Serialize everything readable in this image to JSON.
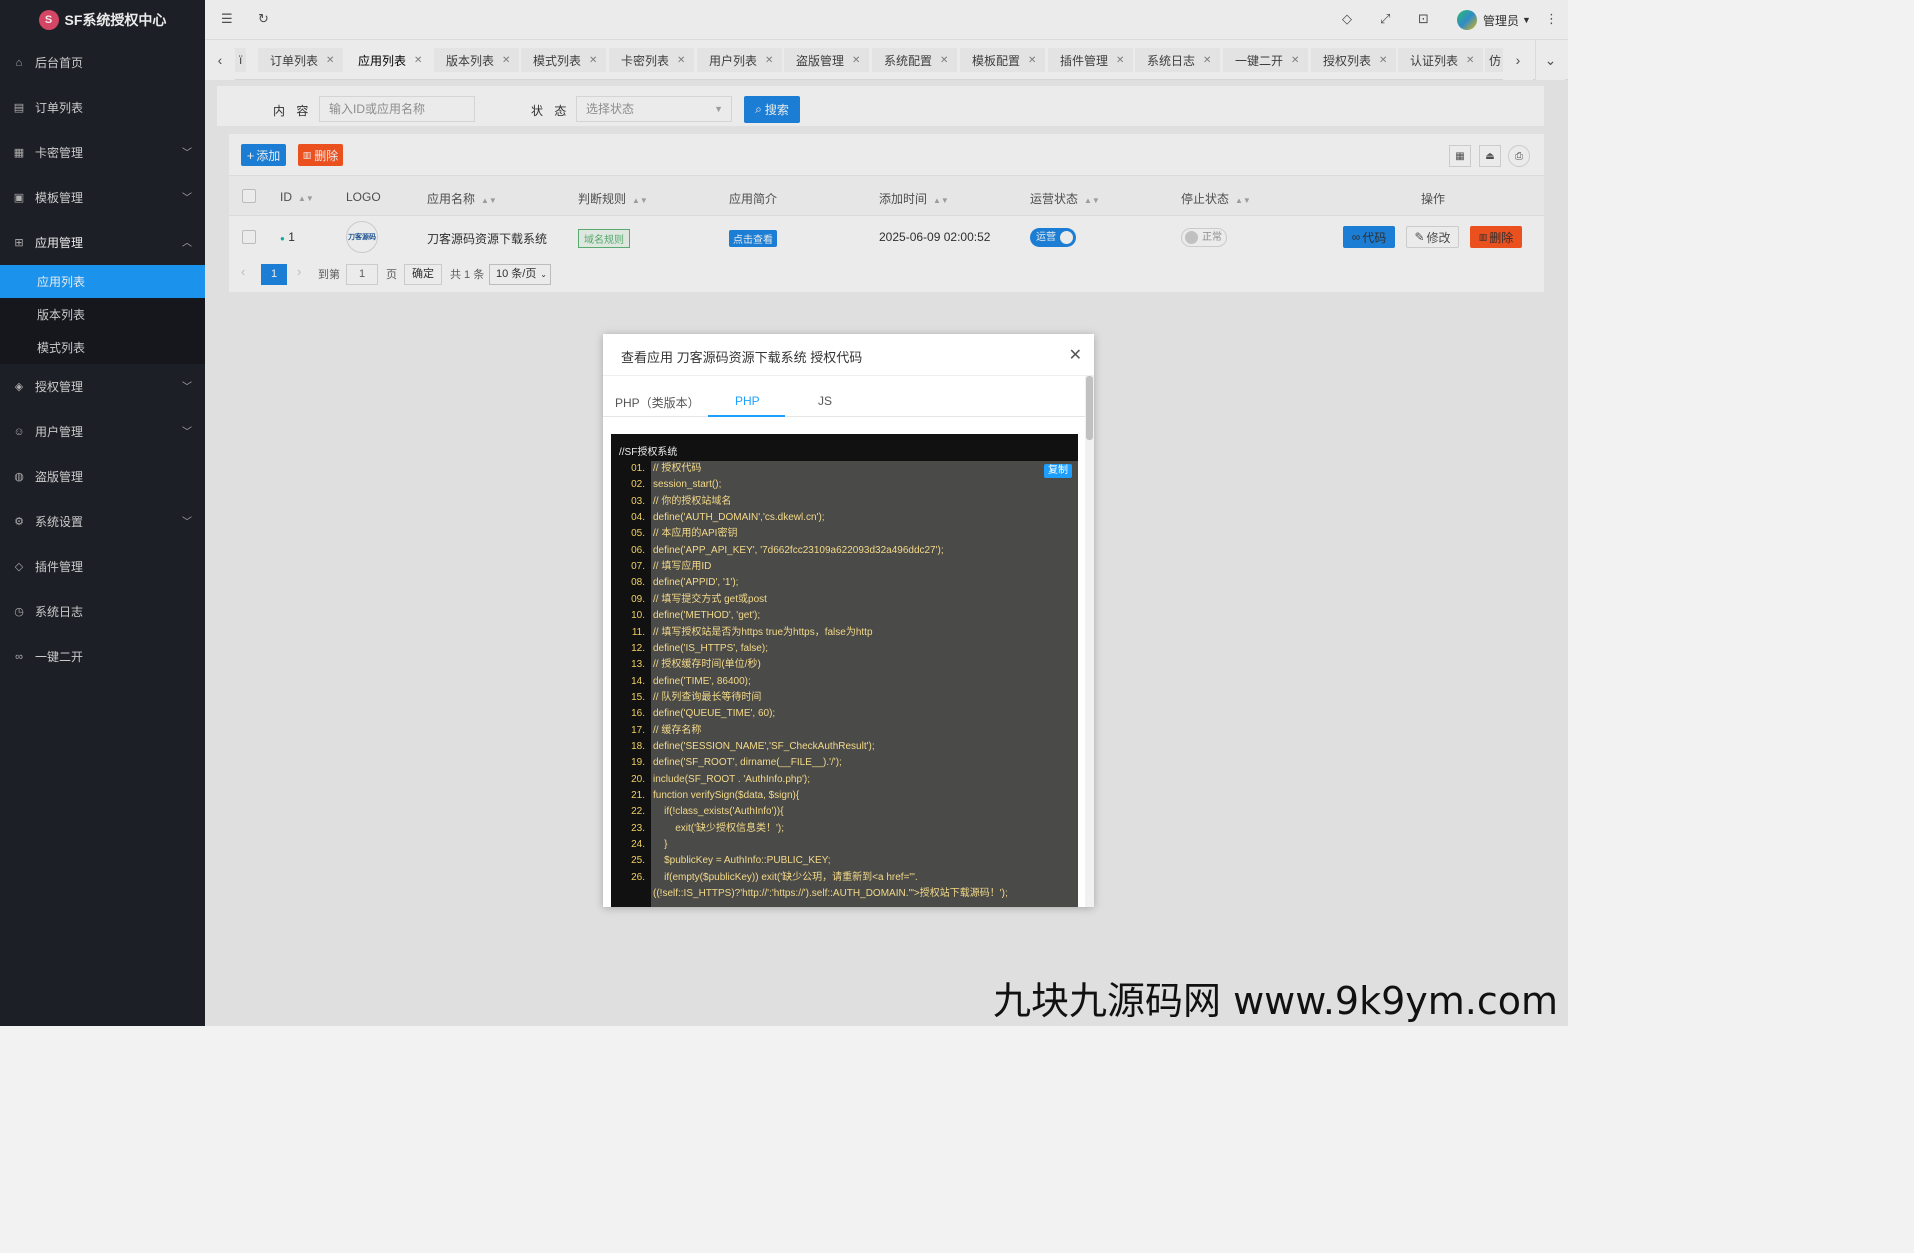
{
  "app": {
    "title": "SF系统授权中心",
    "logo_char": "S"
  },
  "sidebar": {
    "items": [
      {
        "label": "后台首页",
        "icon": "home-icon",
        "glyph": "⌂"
      },
      {
        "label": "订单列表",
        "icon": "document-icon",
        "glyph": "▤"
      },
      {
        "label": "卡密管理",
        "icon": "grid-icon",
        "glyph": "▦"
      },
      {
        "label": "模板管理",
        "icon": "template-icon",
        "glyph": "▣"
      },
      {
        "label": "应用管理",
        "icon": "apps-icon",
        "glyph": "⊞"
      },
      {
        "label": "授权管理",
        "icon": "shield-icon",
        "glyph": "◈"
      },
      {
        "label": "用户管理",
        "icon": "user-icon",
        "glyph": "☺"
      },
      {
        "label": "盗版管理",
        "icon": "globe-icon",
        "glyph": "◍"
      },
      {
        "label": "系统设置",
        "icon": "gear-icon",
        "glyph": "⚙"
      },
      {
        "label": "插件管理",
        "icon": "cube-icon",
        "glyph": "◇"
      },
      {
        "label": "系统日志",
        "icon": "clock-icon",
        "glyph": "◷"
      },
      {
        "label": "一键二开",
        "icon": "link-icon",
        "glyph": "∞"
      }
    ],
    "sub_items": [
      "应用列表",
      "版本列表",
      "模式列表"
    ]
  },
  "topbar": {
    "admin_name": "管理员"
  },
  "tabs": {
    "items": [
      "订单列表",
      "应用列表",
      "版本列表",
      "模式列表",
      "卡密列表",
      "用户列表",
      "盗版管理",
      "系统配置",
      "模板配置",
      "插件管理",
      "系统日志",
      "一键二开",
      "授权列表",
      "认证列表"
    ],
    "partial_left": "ï",
    "partial_right": "仿"
  },
  "search": {
    "content_label": "内 容",
    "content_placeholder": "输入ID或应用名称",
    "status_label": "状 态",
    "status_placeholder": "选择状态",
    "search_button": "搜索"
  },
  "toolbar": {
    "add_label": "添加",
    "delete_label": "删除"
  },
  "table": {
    "headers": [
      "ID",
      "LOGO",
      "应用名称",
      "判断规则",
      "应用简介",
      "添加时间",
      "运营状态",
      "停止状态",
      "操作"
    ],
    "row": {
      "id": "1",
      "logo_text": "刀客源码",
      "name": "刀客源码资源下载系统",
      "rule": "域名规则",
      "intro": "点击查看",
      "time": "2025-06-09 02:00:52",
      "run_status": "运营",
      "stop_status": "正常",
      "code_btn": "代码",
      "edit_btn": "修改",
      "del_btn": "删除"
    }
  },
  "pager": {
    "page": "1",
    "goto_label": "到第",
    "goto_value": "1",
    "page_unit": "页",
    "confirm": "确定",
    "total": "共 1 条",
    "per_page": "10 条/页"
  },
  "modal": {
    "title": "查看应用 刀客源码资源下载系统 授权代码",
    "tabs": [
      "PHP（类版本）",
      "PHP",
      "JS"
    ],
    "code_header": "//SF授权系统",
    "copy_label": "复制",
    "lines": [
      {
        "n": "01.",
        "t": "// 授权代码"
      },
      {
        "n": "02.",
        "t": "session_start();"
      },
      {
        "n": "03.",
        "t": "// 你的授权站域名"
      },
      {
        "n": "04.",
        "t": "define('AUTH_DOMAIN','cs.dkewl.cn');"
      },
      {
        "n": "05.",
        "t": "// 本应用的API密钥"
      },
      {
        "n": "06.",
        "t": "define('APP_API_KEY', '7d662fcc23109a622093d32a496ddc27');"
      },
      {
        "n": "07.",
        "t": "// 填写应用ID"
      },
      {
        "n": "08.",
        "t": "define('APPID', '1');"
      },
      {
        "n": "09.",
        "t": "// 填写提交方式 get或post"
      },
      {
        "n": "10.",
        "t": "define('METHOD', 'get');"
      },
      {
        "n": "11.",
        "t": "// 填写授权站是否为https true为https，false为http"
      },
      {
        "n": "12.",
        "t": "define('IS_HTTPS', false);"
      },
      {
        "n": "13.",
        "t": "// 授权缓存时间(单位/秒)"
      },
      {
        "n": "14.",
        "t": "define('TIME', 86400);"
      },
      {
        "n": "15.",
        "t": "// 队列查询最长等待时间"
      },
      {
        "n": "16.",
        "t": "define('QUEUE_TIME', 60);"
      },
      {
        "n": "17.",
        "t": "// 缓存名称"
      },
      {
        "n": "18.",
        "t": "define('SESSION_NAME','SF_CheckAuthResult');"
      },
      {
        "n": "19.",
        "t": "define('SF_ROOT', dirname(__FILE__).'/');"
      },
      {
        "n": "20.",
        "t": "include(SF_ROOT . 'AuthInfo.php');"
      },
      {
        "n": "21.",
        "t": "function verifySign($data, $sign){"
      },
      {
        "n": "22.",
        "t": "    if(!class_exists('AuthInfo')){"
      },
      {
        "n": "23.",
        "t": "        exit('缺少授权信息类！');"
      },
      {
        "n": "24.",
        "t": "    }"
      },
      {
        "n": "25.",
        "t": "    $publicKey = AuthInfo::PUBLIC_KEY;"
      },
      {
        "n": "26.",
        "t": "    if(empty($publicKey)) exit('缺少公玥，请重新到<a href=\"'."
      },
      {
        "n": "",
        "t": "((!self::IS_HTTPS)?'http://':'https://').self::AUTH_DOMAIN.'\">授权站下载源码！');"
      }
    ]
  },
  "watermark": "九块九源码网 www.9k9ym.com"
}
